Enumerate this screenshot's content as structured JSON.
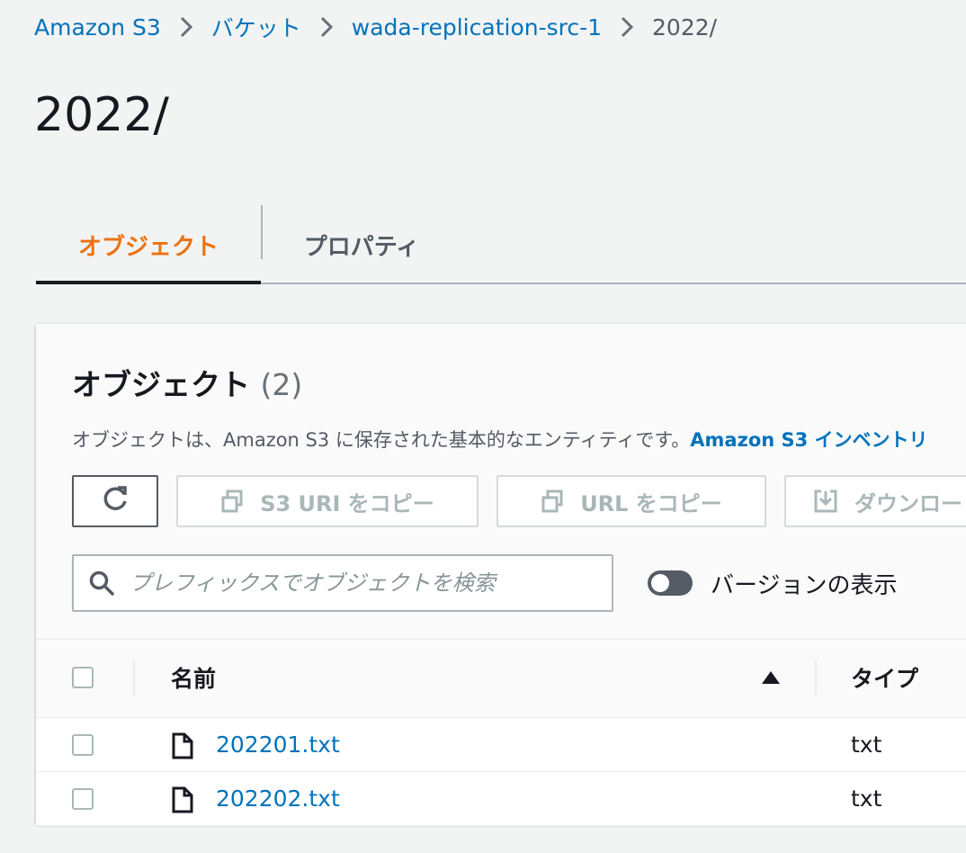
{
  "breadcrumb": {
    "items": [
      "Amazon S3",
      "バケット",
      "wada-replication-src-1"
    ],
    "current": "2022/"
  },
  "page": {
    "title": "2022/"
  },
  "tabs": [
    {
      "label": "オブジェクト",
      "active": true
    },
    {
      "label": "プロパティ",
      "active": false
    }
  ],
  "objects_panel": {
    "title": "オブジェクト",
    "count": "(2)",
    "description": "オブジェクトは、Amazon S3 に保存された基本的なエンティティです。",
    "description_link": "Amazon S3 インベントリ",
    "toolbar": {
      "refresh_icon": "refresh-icon",
      "copy_s3_uri": "S3 URI をコピー",
      "copy_url": "URL をコピー",
      "download": "ダウンロード"
    },
    "search": {
      "placeholder": "プレフィックスでオブジェクトを検索",
      "value": ""
    },
    "show_versions": {
      "label": "バージョンの表示",
      "on": false
    }
  },
  "table": {
    "columns": [
      "名前",
      "タイプ"
    ],
    "sort": {
      "column": "名前",
      "direction": "ascending"
    },
    "rows": [
      {
        "name": "202201.txt",
        "type": "txt",
        "icon": "file-icon"
      },
      {
        "name": "202202.txt",
        "type": "txt",
        "icon": "file-icon"
      }
    ]
  },
  "colors": {
    "link": "#0073bb",
    "active_tab": "#ec7211",
    "text": "#16191f",
    "background": "#f2f3f3"
  }
}
